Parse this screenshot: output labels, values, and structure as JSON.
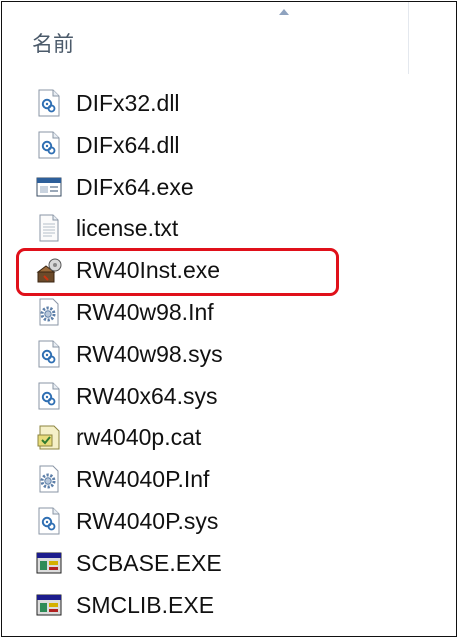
{
  "header": {
    "column_name": "名前",
    "sort_icon": "sort-ascending-icon"
  },
  "files": [
    {
      "name": "DIFx32.dll",
      "icon": "dll-file-icon"
    },
    {
      "name": "DIFx64.dll",
      "icon": "dll-file-icon"
    },
    {
      "name": "DIFx64.exe",
      "icon": "exe-window-icon"
    },
    {
      "name": "license.txt",
      "icon": "text-file-icon"
    },
    {
      "name": "RW40Inst.exe",
      "icon": "installer-icon"
    },
    {
      "name": "RW40w98.Inf",
      "icon": "inf-settings-icon"
    },
    {
      "name": "RW40w98.sys",
      "icon": "sys-file-icon"
    },
    {
      "name": "RW40x64.sys",
      "icon": "sys-file-icon"
    },
    {
      "name": "rw4040p.cat",
      "icon": "catalog-file-icon"
    },
    {
      "name": "RW4040P.Inf",
      "icon": "inf-settings-icon"
    },
    {
      "name": "RW4040P.sys",
      "icon": "sys-file-icon"
    },
    {
      "name": "SCBASE.EXE",
      "icon": "legacy-exe-icon"
    },
    {
      "name": "SMCLIB.EXE",
      "icon": "legacy-exe-icon"
    }
  ],
  "highlighted_file": "RW40Inst.exe",
  "colors": {
    "highlight_border": "#e0101a",
    "header_text": "#4b5a6a"
  }
}
